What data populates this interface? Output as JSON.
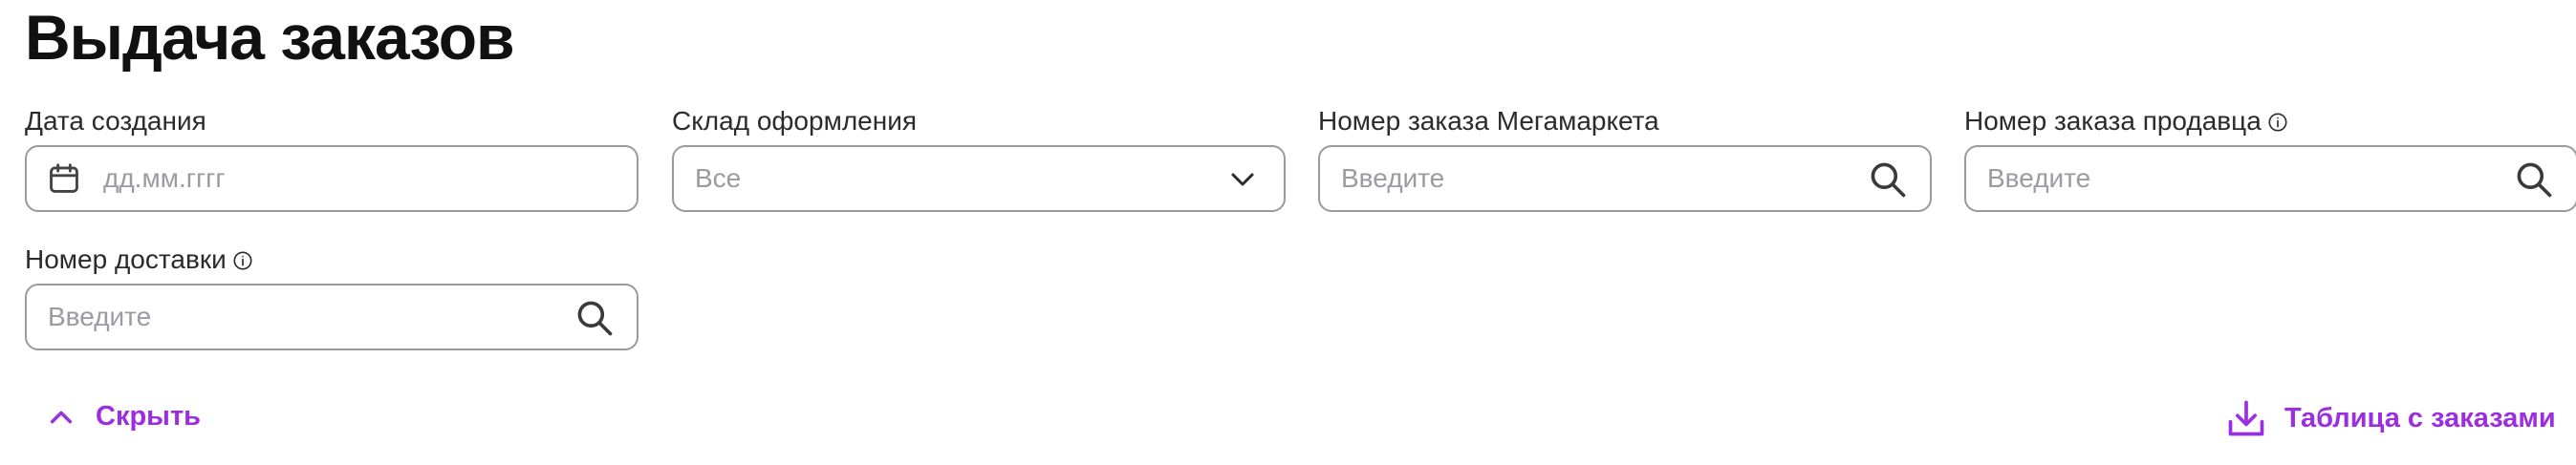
{
  "header": {
    "title": "Выдача заказов"
  },
  "filters": {
    "creation_date": {
      "label": "Дата создания",
      "placeholder": "дд.мм.гггг",
      "icon": "calendar-icon"
    },
    "warehouse": {
      "label": "Склад оформления",
      "selected": "Все",
      "icon": "chevron-down-icon"
    },
    "megamarket_order": {
      "label": "Номер заказа Мегамаркета",
      "placeholder": "Введите",
      "icon": "search-icon"
    },
    "seller_order": {
      "label": "Номер заказа продавца",
      "placeholder": "Введите",
      "icon": "search-icon",
      "info_icon": "info-icon"
    },
    "delivery_number": {
      "label": "Номер доставки",
      "placeholder": "Введите",
      "icon": "search-icon",
      "info_icon": "info-icon"
    }
  },
  "actions": {
    "collapse_label": "Скрыть",
    "collapse_icon": "chevron-up-icon",
    "export_label": "Таблица с заказами",
    "export_icon": "download-icon"
  },
  "colors": {
    "accent": "#9a2ee0",
    "border": "#9a9aa0",
    "placeholder": "#9b9ba1",
    "title": "#111111"
  }
}
